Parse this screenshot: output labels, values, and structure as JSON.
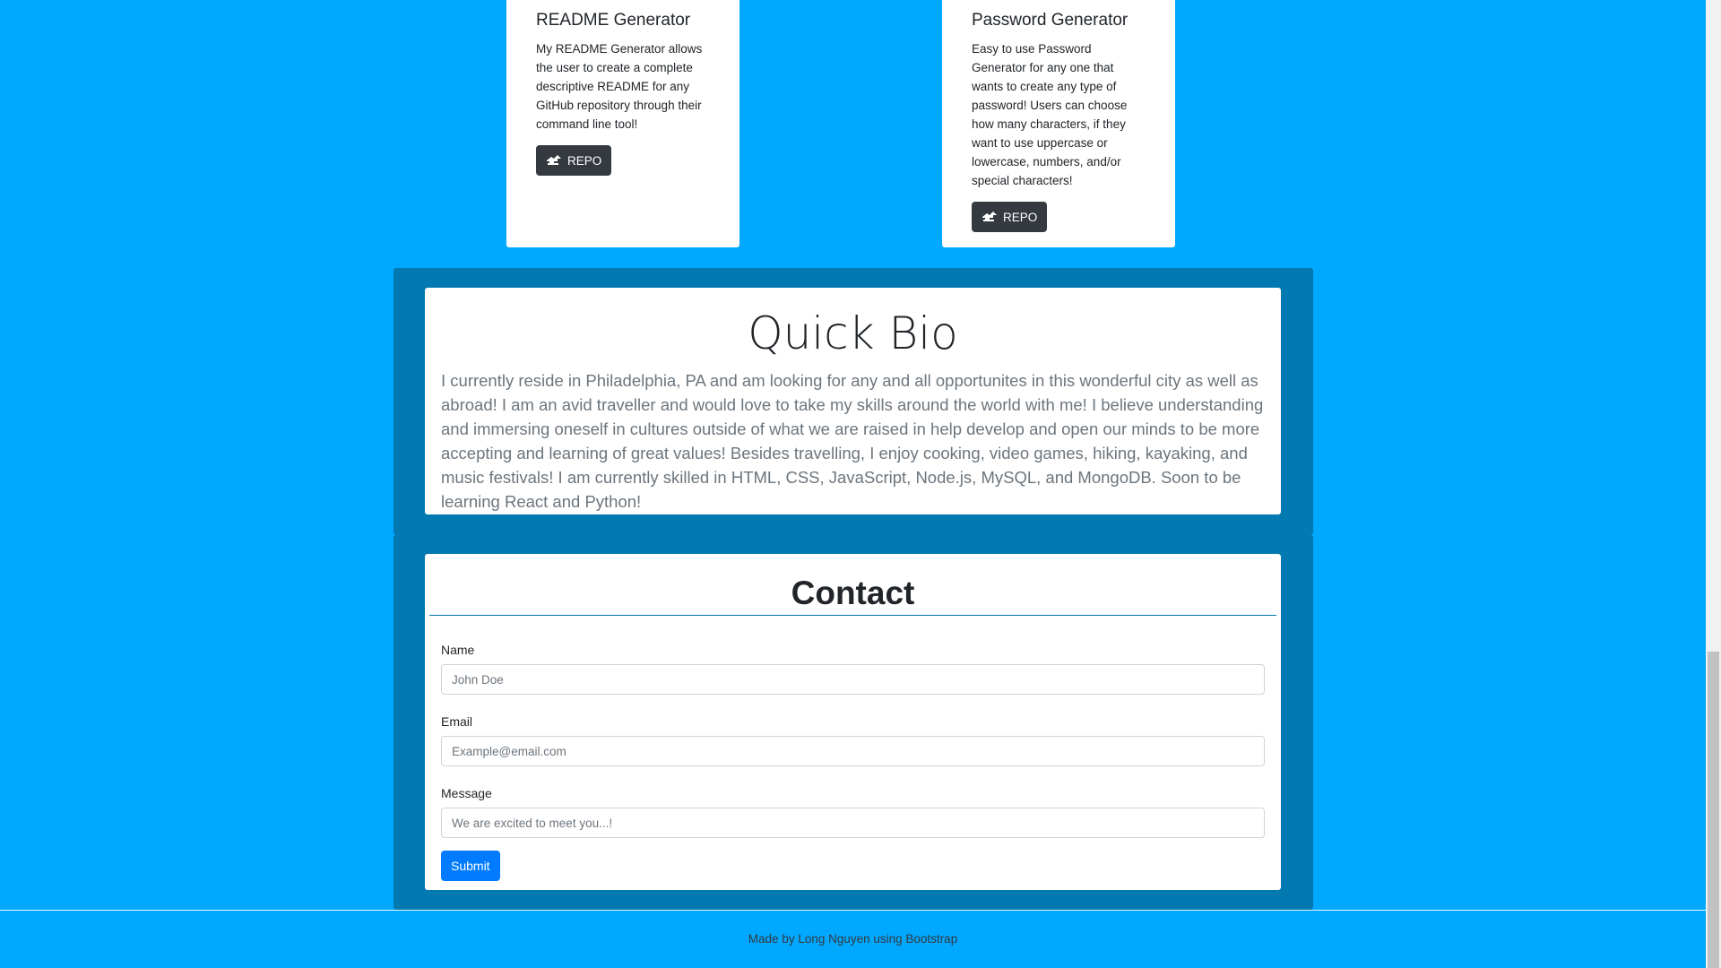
{
  "projects": [
    {
      "title": "README Generator",
      "description": "My README Generator allows the user to create a complete descriptive README for any GitHub repository through their command line tool!",
      "button_label": "REPO",
      "button_icon": "github-icon"
    },
    {
      "title": "Password Generator",
      "description": "Easy to use Password Generator for any one that wants to create any type of password! Users can choose how many characters, if they want to use uppercase or lowercase, numbers, and/or special characters!",
      "button_label": "REPO",
      "button_icon": "github-icon"
    }
  ],
  "bio": {
    "title": "Quick Bio",
    "text": "I currently reside in Philadelphia, PA and am looking for any and all opportunites in this wonderful city as well as abroad! I am an avid traveller and would love to take my skills around the world with me! I believe understanding and immersing oneself in cultures outside of what we are raised in help develop and open our minds to be more accepting and learning of great values! Besides travelling, I enjoy cooking, video games, hiking, kayaking, and music festivals! I am currently skilled in HTML, CSS, JavaScript, Node.js, MySQL, and MongoDB. Soon to be learning React and Python!"
  },
  "contact": {
    "title": "Contact",
    "name_label": "Name",
    "name_placeholder": "John Doe",
    "email_label": "Email",
    "email_placeholder": "Example@email.com",
    "message_label": "Message",
    "message_placeholder": "We are excited to meet you...!",
    "submit_label": "Submit"
  },
  "footer": {
    "text": "Made by Long Nguyen using Bootstrap"
  },
  "colors": {
    "page_background": "#00a8ff",
    "panel_background": "#0279b0",
    "repo_button": "#343a40",
    "submit_button": "#007bff"
  }
}
